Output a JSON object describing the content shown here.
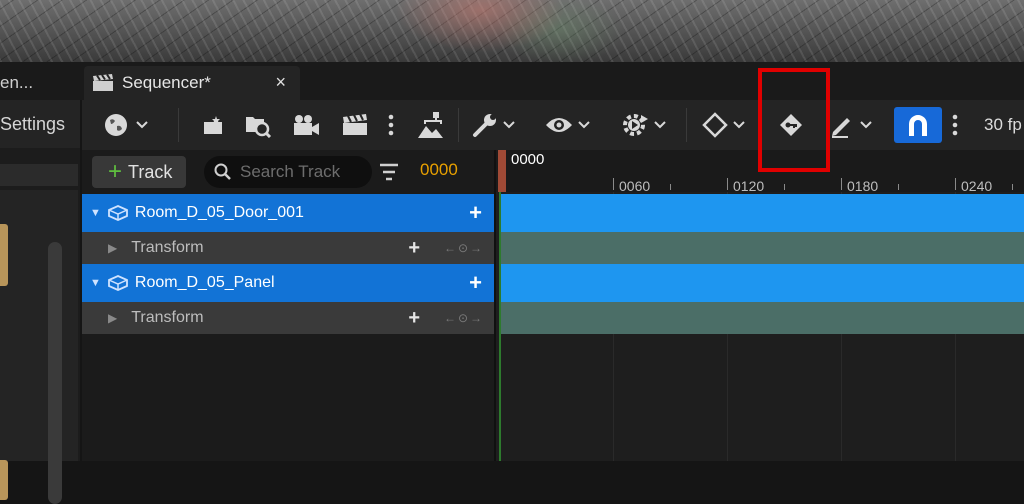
{
  "window": {
    "left_tab_label": "en...",
    "sequencer_tab_label": "Sequencer*",
    "close_glyph": "×"
  },
  "left_panel": {
    "settings_label": "Settings"
  },
  "toolbar": {
    "fps_label": "30 fp",
    "icons": [
      "world-icon",
      "render-settings-icon",
      "find-in-content-icon",
      "camera-icon",
      "clapperboard-icon",
      "more-vertical-icon",
      "hierarchy-icon",
      "wrench-icon",
      "eye-icon",
      "gear-play-icon",
      "key-diamond-icon",
      "key-tag-icon",
      "pencil-icon",
      "magnet-icon"
    ],
    "highlight_color": "#e00000",
    "snap_accent": "#1769d8"
  },
  "outliner": {
    "add_track_label": "Track",
    "search_placeholder": "Search Track",
    "current_frame": "0000",
    "rows": [
      {
        "type": "actor",
        "label": "Room_D_05_Door_001"
      },
      {
        "type": "sub",
        "label": "Transform"
      },
      {
        "type": "actor",
        "label": "Room_D_05_Panel"
      },
      {
        "type": "sub",
        "label": "Transform"
      }
    ]
  },
  "timeline": {
    "playhead_label": "0000",
    "ticks": [
      "0060",
      "0120",
      "0180",
      "0240"
    ],
    "actor_lane_color": "#1e96f0",
    "sub_lane_color": "#4b6e67"
  }
}
